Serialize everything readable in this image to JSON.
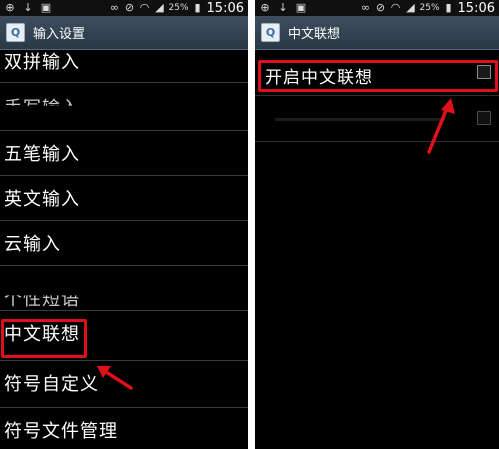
{
  "left_screen": {
    "status": {
      "battery": "25%",
      "time": "15:06"
    },
    "title": "输入设置",
    "app_icon_letter": "Q",
    "items": [
      {
        "label": "双拼输入"
      },
      {
        "label": "手写输入"
      },
      {
        "label": "五笔输入"
      },
      {
        "label": "英文输入"
      },
      {
        "label": "云输入"
      },
      {
        "label": "个性短语"
      },
      {
        "label": "中文联想"
      },
      {
        "label": "符号自定义"
      },
      {
        "label": "符号文件管理"
      }
    ]
  },
  "right_screen": {
    "status": {
      "battery": "25%",
      "time": "15:06"
    },
    "title": "中文联想",
    "app_icon_letter": "Q",
    "items": [
      {
        "label": "开启中文联想",
        "checked": false
      },
      {
        "label": "",
        "checked": false
      }
    ]
  },
  "colors": {
    "highlight": "#e0101a",
    "title_bar": "#34434f",
    "background": "#000000"
  }
}
